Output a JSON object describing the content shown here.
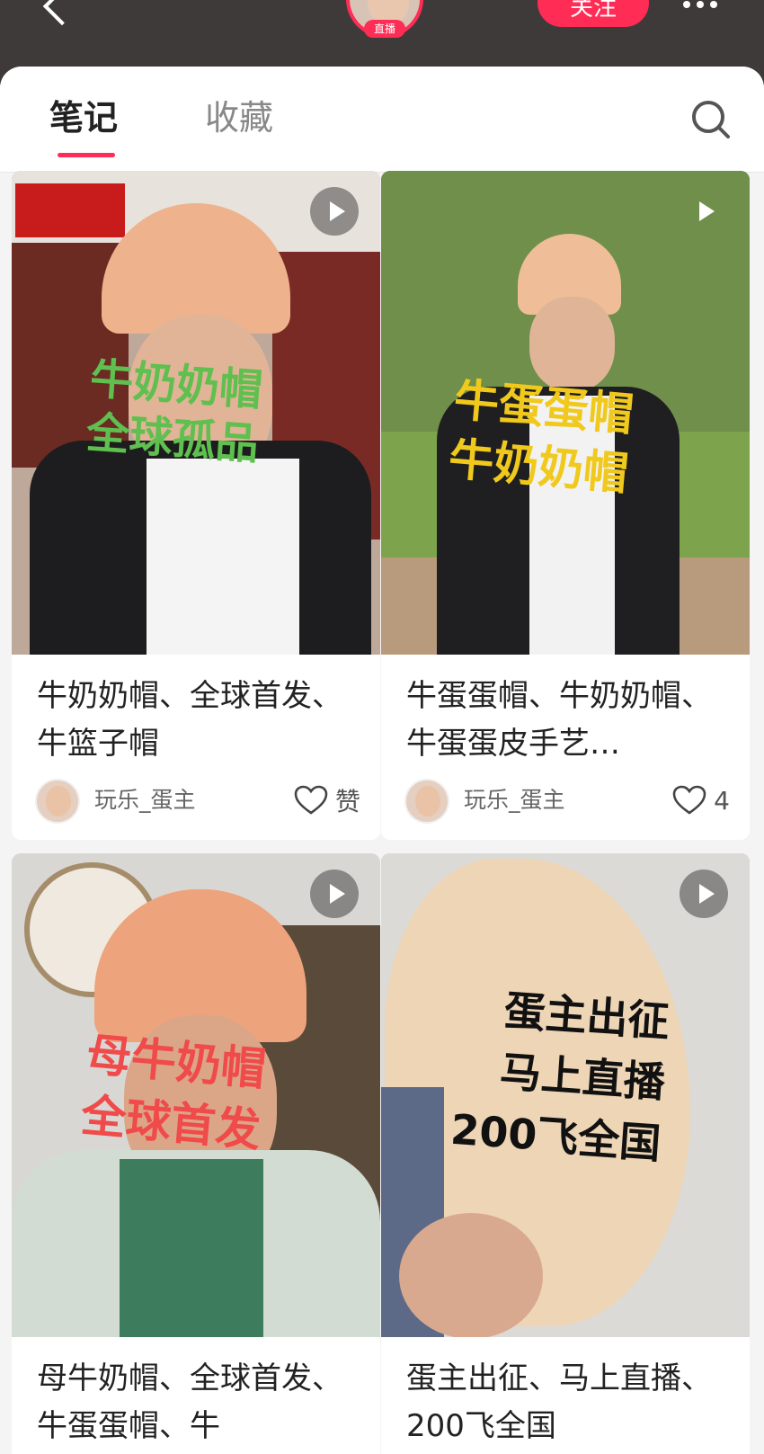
{
  "header": {
    "follow_label": "关注",
    "live_badge": "直播"
  },
  "tabs": [
    {
      "label": "笔记",
      "active": true
    },
    {
      "label": "收藏",
      "active": false
    }
  ],
  "accent_color": "#ff2c55",
  "icons": {
    "back": "chevron-left-icon",
    "more": "more-dots-icon",
    "search": "search-icon",
    "play": "play-icon",
    "like": "heart-outline-icon"
  },
  "notes": [
    {
      "overlay": "牛奶奶帽\n全球孤品",
      "overlay_color": "#5fbf4f",
      "title": "牛奶奶帽、全球首发、牛篮子帽",
      "author": "玩乐_蛋主",
      "likes": "赞"
    },
    {
      "overlay": "牛蛋蛋帽\n牛奶奶帽",
      "overlay_color": "#f0c91c",
      "title": "牛蛋蛋帽、牛奶奶帽、牛蛋蛋皮手艺…",
      "author": "玩乐_蛋主",
      "likes": "4"
    },
    {
      "overlay": "母牛奶帽\n全球首发",
      "overlay_color": "#f04a4a",
      "title": "母牛奶帽、全球首发、牛蛋蛋帽、牛",
      "author": "",
      "likes": ""
    },
    {
      "overlay": "蛋主出征\n马上直播\n200飞全国",
      "overlay_color": "#111111",
      "title": "蛋主出征、马上直播、200飞全国",
      "author": "",
      "likes": ""
    }
  ]
}
